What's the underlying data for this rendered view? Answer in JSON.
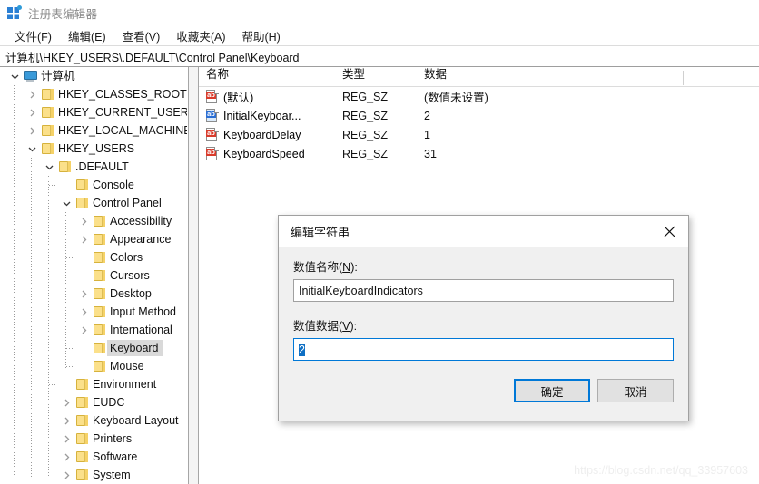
{
  "window": {
    "title": "注册表编辑器",
    "icon": "registry-editor-icon"
  },
  "menubar": {
    "items": [
      {
        "label": "文件(F)",
        "name": "menu-file"
      },
      {
        "label": "编辑(E)",
        "name": "menu-edit"
      },
      {
        "label": "查看(V)",
        "name": "menu-view"
      },
      {
        "label": "收藏夹(A)",
        "name": "menu-favorites"
      },
      {
        "label": "帮助(H)",
        "name": "menu-help"
      }
    ]
  },
  "address": {
    "path": "计算机\\HKEY_USERS\\.DEFAULT\\Control Panel\\Keyboard"
  },
  "tree": {
    "nodes": [
      {
        "label": "计算机",
        "depth": 0,
        "icon": "computer-icon",
        "twist": "expanded",
        "selected": false
      },
      {
        "label": "HKEY_CLASSES_ROOT",
        "depth": 1,
        "icon": "folder-icon",
        "twist": "collapsed",
        "selected": false
      },
      {
        "label": "HKEY_CURRENT_USER",
        "depth": 1,
        "icon": "folder-icon",
        "twist": "collapsed",
        "selected": false
      },
      {
        "label": "HKEY_LOCAL_MACHINE",
        "depth": 1,
        "icon": "folder-icon",
        "twist": "collapsed",
        "selected": false
      },
      {
        "label": "HKEY_USERS",
        "depth": 1,
        "icon": "folder-icon",
        "twist": "expanded",
        "selected": false
      },
      {
        "label": ".DEFAULT",
        "depth": 2,
        "icon": "folder-icon",
        "twist": "expanded",
        "selected": false
      },
      {
        "label": "Console",
        "depth": 3,
        "icon": "folder-icon",
        "twist": "leaf",
        "selected": false
      },
      {
        "label": "Control Panel",
        "depth": 3,
        "icon": "folder-icon",
        "twist": "expanded",
        "selected": false
      },
      {
        "label": "Accessibility",
        "depth": 4,
        "icon": "folder-icon",
        "twist": "collapsed",
        "selected": false
      },
      {
        "label": "Appearance",
        "depth": 4,
        "icon": "folder-icon",
        "twist": "collapsed",
        "selected": false
      },
      {
        "label": "Colors",
        "depth": 4,
        "icon": "folder-icon",
        "twist": "leaf",
        "selected": false
      },
      {
        "label": "Cursors",
        "depth": 4,
        "icon": "folder-icon",
        "twist": "leaf",
        "selected": false
      },
      {
        "label": "Desktop",
        "depth": 4,
        "icon": "folder-icon",
        "twist": "collapsed",
        "selected": false
      },
      {
        "label": "Input Method",
        "depth": 4,
        "icon": "folder-icon",
        "twist": "collapsed",
        "selected": false
      },
      {
        "label": "International",
        "depth": 4,
        "icon": "folder-icon",
        "twist": "collapsed",
        "selected": false
      },
      {
        "label": "Keyboard",
        "depth": 4,
        "icon": "folder-icon",
        "twist": "leaf",
        "selected": true
      },
      {
        "label": "Mouse",
        "depth": 4,
        "icon": "folder-icon",
        "twist": "leaf",
        "selected": false
      },
      {
        "label": "Environment",
        "depth": 3,
        "icon": "folder-icon",
        "twist": "leaf",
        "selected": false
      },
      {
        "label": "EUDC",
        "depth": 3,
        "icon": "folder-icon",
        "twist": "collapsed",
        "selected": false
      },
      {
        "label": "Keyboard Layout",
        "depth": 3,
        "icon": "folder-icon",
        "twist": "collapsed",
        "selected": false
      },
      {
        "label": "Printers",
        "depth": 3,
        "icon": "folder-icon",
        "twist": "collapsed",
        "selected": false
      },
      {
        "label": "Software",
        "depth": 3,
        "icon": "folder-icon",
        "twist": "collapsed",
        "selected": false
      },
      {
        "label": "System",
        "depth": 3,
        "icon": "folder-icon",
        "twist": "collapsed",
        "selected": false
      }
    ]
  },
  "list": {
    "columns": [
      "名称",
      "类型",
      "数据"
    ],
    "rows": [
      {
        "name": "(默认)",
        "type": "REG_SZ",
        "data": "(数值未设置)",
        "icon": "string-value-icon",
        "selected": false
      },
      {
        "name": "InitialKeyboar...",
        "type": "REG_SZ",
        "data": "2",
        "icon": "string-value-icon",
        "selected": true
      },
      {
        "name": "KeyboardDelay",
        "type": "REG_SZ",
        "data": "1",
        "icon": "string-value-icon",
        "selected": false
      },
      {
        "name": "KeyboardSpeed",
        "type": "REG_SZ",
        "data": "31",
        "icon": "string-value-icon",
        "selected": false
      }
    ]
  },
  "dialog": {
    "title": "编辑字符串",
    "close_icon": "close-icon",
    "name_label_pre": "数值名称(",
    "name_label_key": "N",
    "name_label_post": "):",
    "name_value": "InitialKeyboardIndicators",
    "data_label_pre": "数值数据(",
    "data_label_key": "V",
    "data_label_post": "):",
    "data_value": "2",
    "ok_label": "确定",
    "cancel_label": "取消"
  },
  "watermark": {
    "text": "https://blog.csdn.net/qq_33957603"
  },
  "colors": {
    "accent": "#0078d7",
    "selection": "#0e6fc4",
    "folder": "#fbe08a",
    "tree_selection": "#d9d9d9"
  }
}
